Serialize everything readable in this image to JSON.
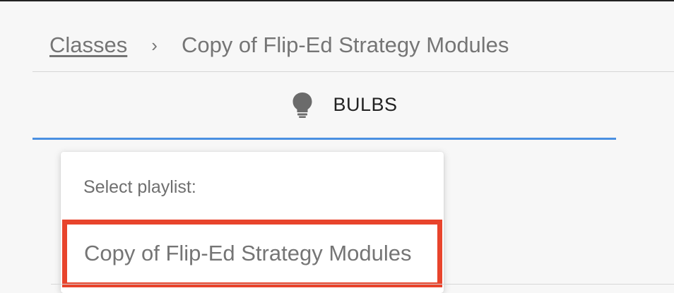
{
  "breadcrumb": {
    "parent": "Classes",
    "separator": "›",
    "current": "Copy of Flip-Ed Strategy Modules"
  },
  "tab": {
    "icon": "bulb-icon",
    "label": "BULBS",
    "active_color": "#4a90e2"
  },
  "dropdown": {
    "title": "Select playlist:",
    "options": [
      {
        "label": "Copy of Flip-Ed Strategy Modules",
        "highlight_color": "#e8442c"
      }
    ]
  }
}
